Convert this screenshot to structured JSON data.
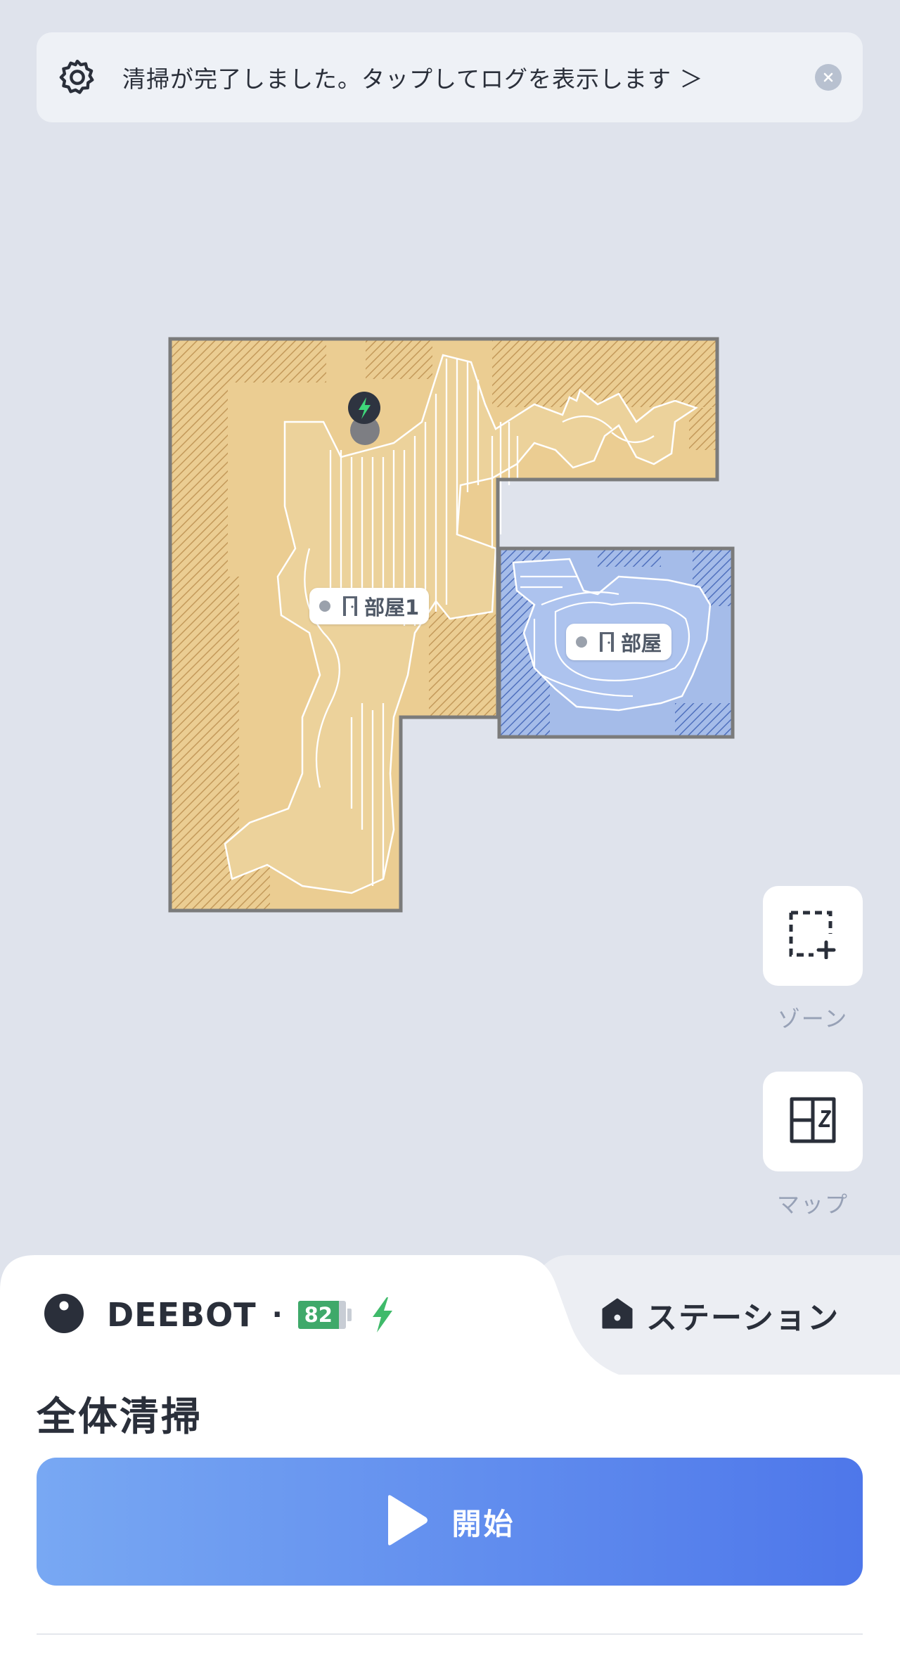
{
  "banner": {
    "message": "清掃が完了しました。タップしてログを表示します ＞",
    "icons": {
      "leading": "gear-icon",
      "trailing": "close-icon"
    }
  },
  "map": {
    "rooms": [
      {
        "label": "部屋1",
        "color": "#ebcd92"
      },
      {
        "label": "部屋",
        "color": "#a5bce9"
      }
    ],
    "charger_icon": "lightning-icon"
  },
  "tools": {
    "zone_label": "ゾーン",
    "map_label": "マップ"
  },
  "robot": {
    "name": "DEEBOT",
    "separator": "·",
    "battery": "82",
    "battery_color": "#3fa96a",
    "charging_icon": "lightning-icon",
    "charging_color": "#3fba6a"
  },
  "station": {
    "label": "ステーション",
    "icon": "home-icon"
  },
  "mode": {
    "title": "全体清掃"
  },
  "start_button": {
    "label": "開始",
    "icon": "play-icon"
  },
  "colors": {
    "accent_start": "#78a8f3",
    "accent_end": "#4e77ea",
    "background": "#dfe3ec"
  }
}
